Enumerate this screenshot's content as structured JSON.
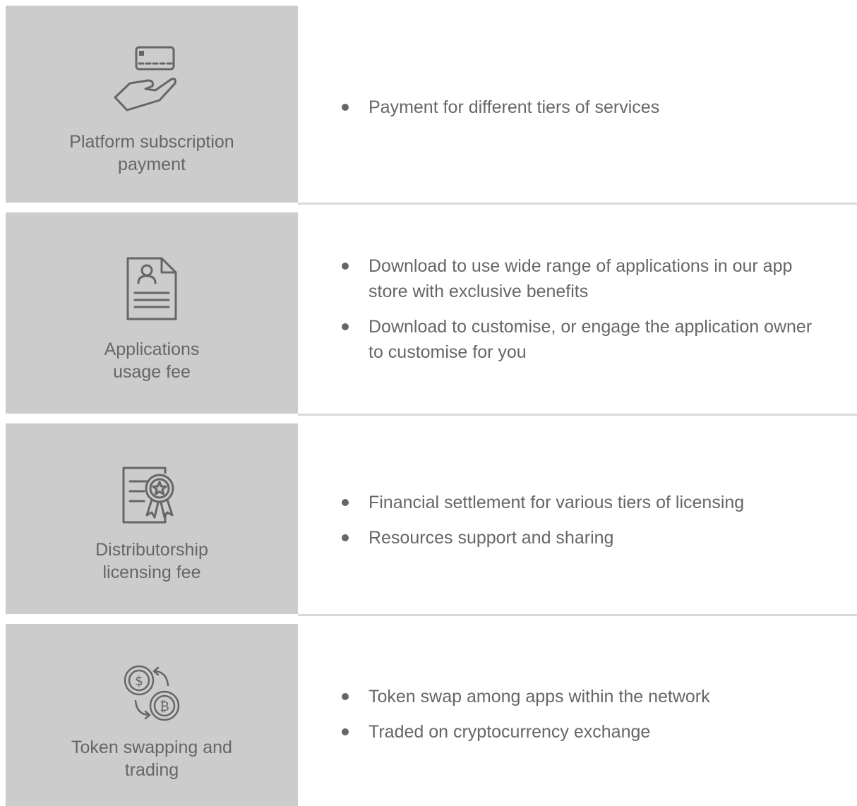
{
  "rows": [
    {
      "icon": "hand-card-icon",
      "label": "Platform subscription\npayment",
      "bullets": [
        "Payment for different tiers of services"
      ]
    },
    {
      "icon": "document-user-icon",
      "label": "Applications\nusage fee",
      "bullets": [
        "Download to use wide range of applications in our app store with exclusive benefits",
        "Download to customise, or engage the application owner to customise for you"
      ]
    },
    {
      "icon": "certificate-icon",
      "label": "Distributorship\nlicensing fee",
      "bullets": [
        "Financial settlement for various tiers of licensing",
        "Resources support and sharing"
      ]
    },
    {
      "icon": "currency-exchange-icon",
      "label": "Token swapping and\ntrading",
      "bullets": [
        "Token swap among apps within the network",
        "Traded on cryptocurrency exchange"
      ]
    }
  ],
  "colors": {
    "panel_gray": "#cccccc",
    "text_gray": "#666666",
    "separator": "#d9d9d9"
  }
}
